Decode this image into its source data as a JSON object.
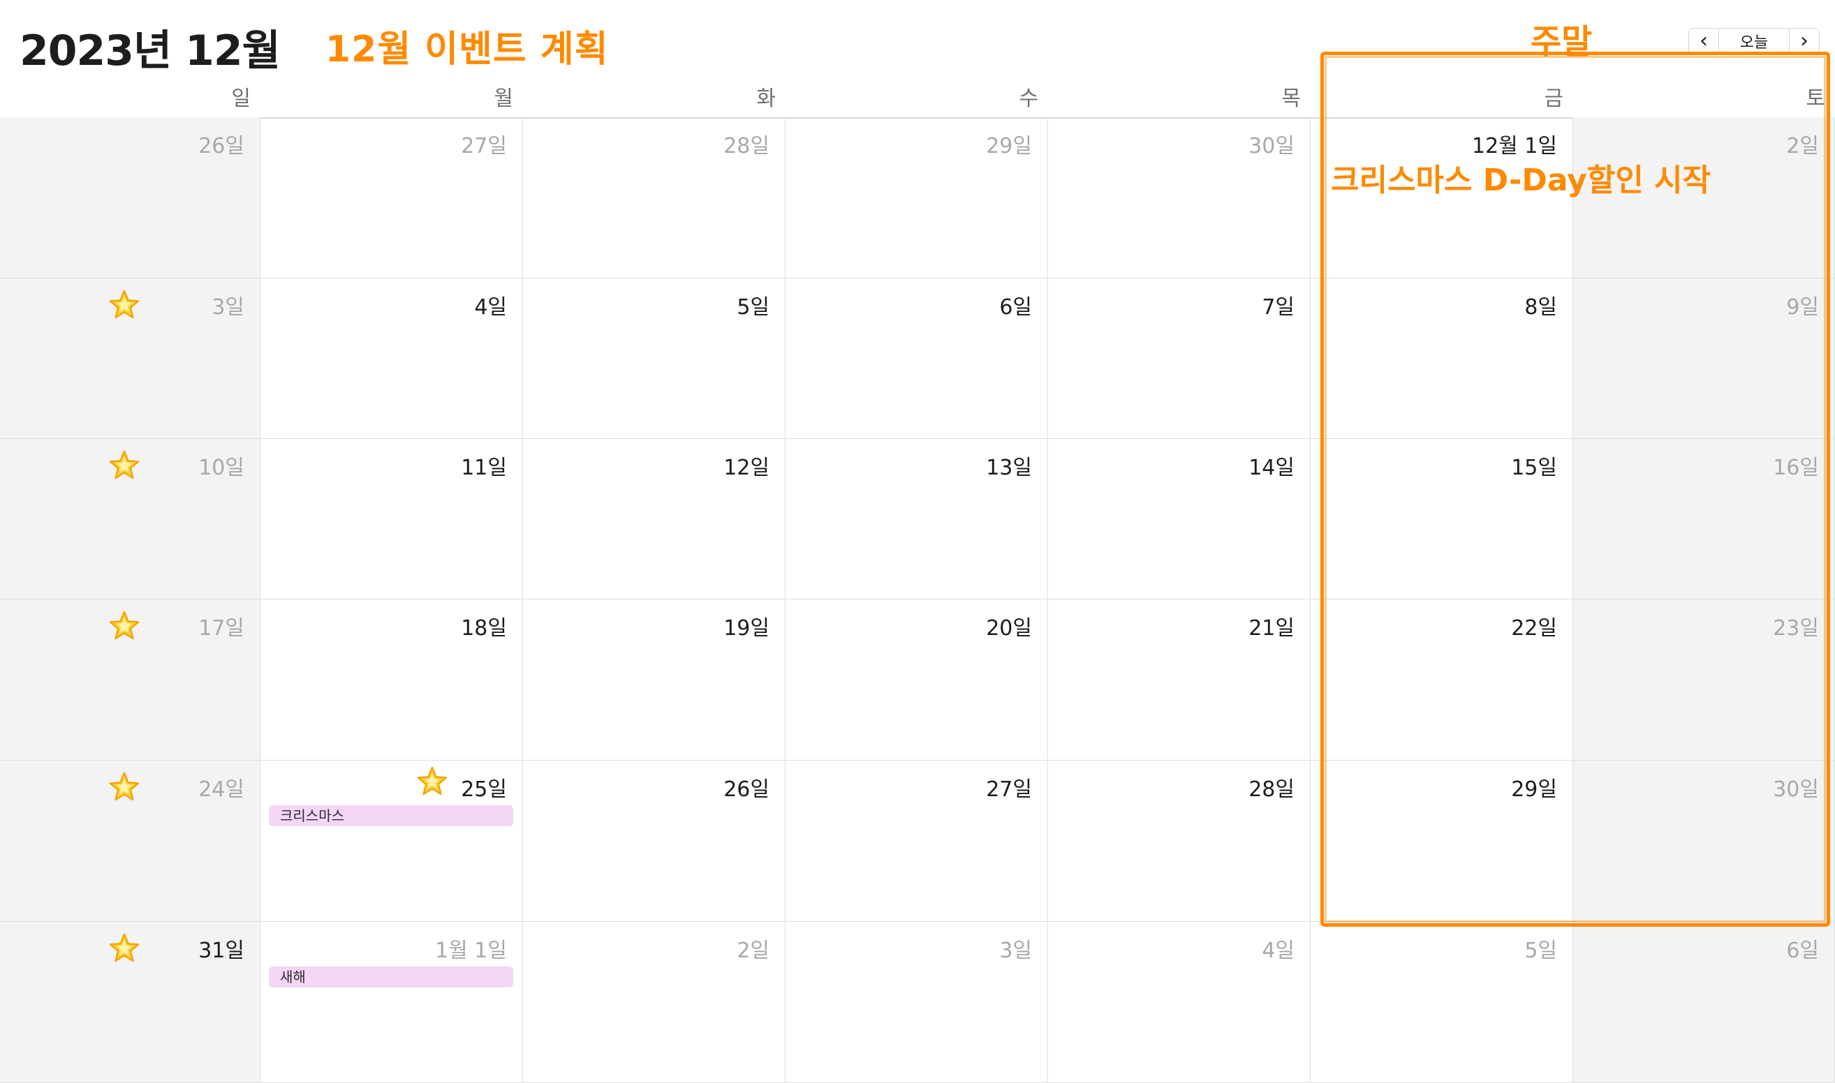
{
  "header": {
    "month_title": "2023년 12월",
    "annotation_title": "12월 이벤트 계획",
    "annotation_weekend": "주말",
    "annotation_sale": "크리스마스 D-Day할인 시작",
    "nav": {
      "prev_icon": "chevron-left-icon",
      "today_label": "오늘",
      "next_icon": "chevron-right-icon"
    }
  },
  "weekdays": [
    "일",
    "월",
    "화",
    "수",
    "목",
    "금",
    "토"
  ],
  "weeks": [
    [
      {
        "label": "26일",
        "muted": true
      },
      {
        "label": "27일",
        "muted": true
      },
      {
        "label": "28일",
        "muted": true
      },
      {
        "label": "29일",
        "muted": true
      },
      {
        "label": "30일",
        "muted": true
      },
      {
        "label": "12월 1일",
        "muted": false
      },
      {
        "label": "2일",
        "muted": true
      }
    ],
    [
      {
        "label": "3일",
        "muted": true,
        "star": true
      },
      {
        "label": "4일",
        "muted": false
      },
      {
        "label": "5일",
        "muted": false
      },
      {
        "label": "6일",
        "muted": false
      },
      {
        "label": "7일",
        "muted": false
      },
      {
        "label": "8일",
        "muted": false
      },
      {
        "label": "9일",
        "muted": true
      }
    ],
    [
      {
        "label": "10일",
        "muted": true,
        "star": true
      },
      {
        "label": "11일",
        "muted": false
      },
      {
        "label": "12일",
        "muted": false
      },
      {
        "label": "13일",
        "muted": false
      },
      {
        "label": "14일",
        "muted": false
      },
      {
        "label": "15일",
        "muted": false
      },
      {
        "label": "16일",
        "muted": true
      }
    ],
    [
      {
        "label": "17일",
        "muted": true,
        "star": true
      },
      {
        "label": "18일",
        "muted": false
      },
      {
        "label": "19일",
        "muted": false
      },
      {
        "label": "20일",
        "muted": false
      },
      {
        "label": "21일",
        "muted": false
      },
      {
        "label": "22일",
        "muted": false
      },
      {
        "label": "23일",
        "muted": true
      }
    ],
    [
      {
        "label": "24일",
        "muted": true,
        "star": true
      },
      {
        "label": "25일",
        "muted": false,
        "star": true,
        "event": "크리스마스"
      },
      {
        "label": "26일",
        "muted": false
      },
      {
        "label": "27일",
        "muted": false
      },
      {
        "label": "28일",
        "muted": false
      },
      {
        "label": "29일",
        "muted": false
      },
      {
        "label": "30일",
        "muted": true
      }
    ],
    [
      {
        "label": "31일",
        "muted": false,
        "star": true
      },
      {
        "label": "1월 1일",
        "muted": true,
        "event": "새해"
      },
      {
        "label": "2일",
        "muted": true
      },
      {
        "label": "3일",
        "muted": true
      },
      {
        "label": "4일",
        "muted": true
      },
      {
        "label": "5일",
        "muted": true
      },
      {
        "label": "6일",
        "muted": true
      }
    ]
  ],
  "colors": {
    "annotation": "#ff8a00",
    "event_bg": "#f3d7f5",
    "weekend_bg": "#f3f3f3"
  }
}
